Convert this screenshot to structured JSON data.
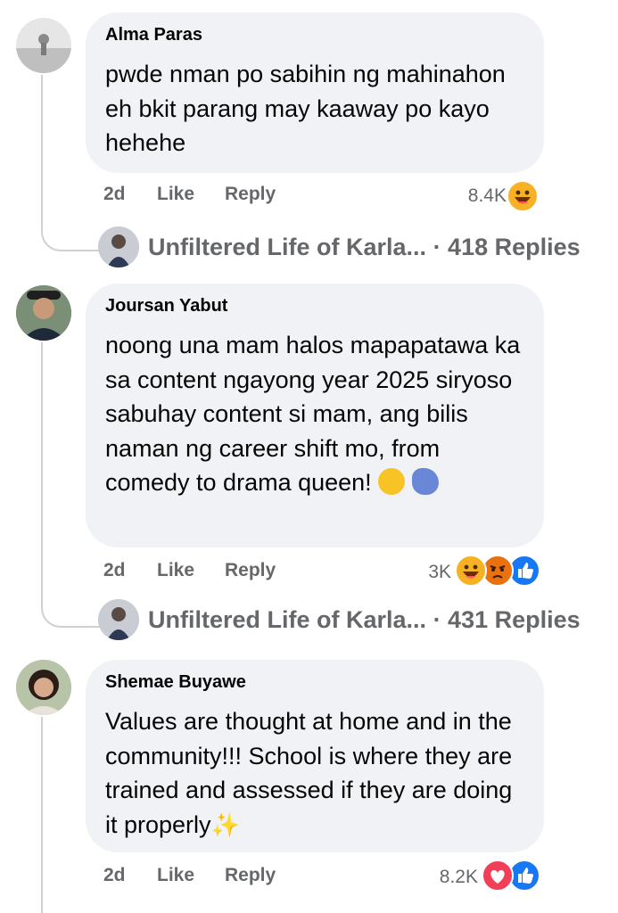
{
  "comments": [
    {
      "author": "Alma Paras",
      "text": "pwde nman po sabihin ng mahinahon eh bkit parang may kaaway po kayo hehehe",
      "time": "2d",
      "like_label": "Like",
      "reply_label": "Reply",
      "reaction_count": "8.4K",
      "reactions": [
        "haha-icon"
      ],
      "replies_author": "Unfiltered Life of Karla...",
      "replies_count": "· 418 Replies"
    },
    {
      "author": "Joursan Yabut",
      "text": "noong una mam halos mapapatawa ka sa content ngayong year 2025 siryoso sabuhay content si mam, ang bilis naman ng career shift mo, from comedy to drama queen!",
      "time": "2d",
      "like_label": "Like",
      "reply_label": "Reply",
      "reaction_count": "3K",
      "reactions": [
        "haha-icon",
        "angry-icon",
        "like-icon"
      ],
      "replies_author": "Unfiltered Life of Karla...",
      "replies_count": "· 431 Replies"
    },
    {
      "author": "Shemae Buyawe",
      "text": "Values are thought at home and in the community!!! School is where they are trained and assessed if they are doing it properly",
      "time": "2d",
      "like_label": "Like",
      "reply_label": "Reply",
      "reaction_count": "8.2K",
      "reactions": [
        "love-icon",
        "like-icon"
      ]
    }
  ],
  "colors": {
    "bubble": "#f0f2f5",
    "meta_text": "#65676b",
    "like_blue": "#1877f2",
    "love_red": "#f33e58",
    "haha_yellow": "#f7b125",
    "angry_orange": "#e9710f"
  }
}
